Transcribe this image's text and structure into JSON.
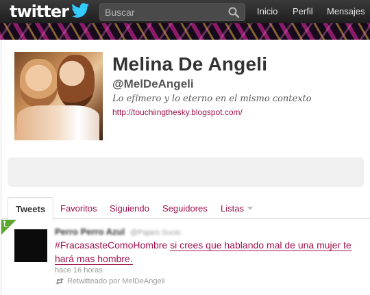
{
  "topbar": {
    "logo_text": "twitter",
    "search_placeholder": "Buscar",
    "nav": [
      "Inicio",
      "Perfil",
      "Mensajes"
    ]
  },
  "profile": {
    "name": "Melina De Angeli",
    "handle": "@MelDeAngeli",
    "bio": "Lo efímero y lo eterno en el mismo contexto",
    "url": "http://touchiingthesky.blogspot.com/"
  },
  "tabs": [
    "Tweets",
    "Favoritos",
    "Siguiendo",
    "Seguidores",
    "Listas"
  ],
  "tweet": {
    "author_name": "Perro Perro Azul",
    "author_user": "@Pajaro Sucio",
    "hashtag": "#FracasasteComoHombre",
    "text": "si crees que hablando mal de una mujer te hará mas hombre.",
    "time": "hace 16 horas",
    "retweeted_by": "Retwitteado por MelDeAngeli"
  },
  "colors": {
    "topbar": "#1e1e1e",
    "link": "#a0114d",
    "retweet_corner": "#5fa82f",
    "text": "#333333"
  }
}
